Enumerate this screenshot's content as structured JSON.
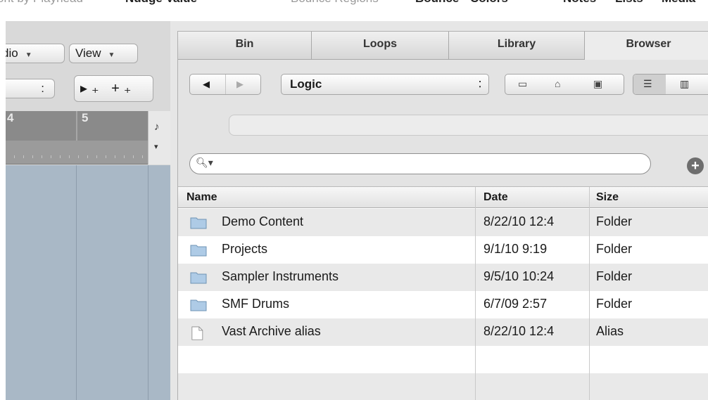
{
  "top_toolbar": {
    "cropped_left": "ont by Playhead",
    "nudge_value": "Nudge Value",
    "bounce_regions": "Bounce Regions",
    "bounce": "Bounce",
    "colors": "Colors",
    "notes": "Notes",
    "lists": "Lists",
    "media": "Media"
  },
  "arrange": {
    "audio_menu": "dio",
    "view_menu": "View",
    "stepper_value": ":",
    "tools": "▸₊ +₊",
    "ruler_bar_4": "4",
    "ruler_bar_5": "5",
    "ruler_note": "♪",
    "ruler_arrow": "▾"
  },
  "browser": {
    "tabs": [
      {
        "label": "Bin",
        "active": false
      },
      {
        "label": "Loops",
        "active": false
      },
      {
        "label": "Library",
        "active": false
      },
      {
        "label": "Browser",
        "active": true
      }
    ],
    "location": "Logic",
    "search": {
      "value": "",
      "placeholder": ""
    },
    "columns": {
      "name": "Name",
      "date": "Date",
      "size": "Size"
    },
    "rows": [
      {
        "icon": "folder-icon",
        "name": "Demo Content",
        "date": "8/22/10 12:4",
        "size": "Folder"
      },
      {
        "icon": "folder-icon",
        "name": "Projects",
        "date": "9/1/10 9:19",
        "size": "Folder"
      },
      {
        "icon": "folder-icon",
        "name": "Sampler Instruments",
        "date": "9/5/10 10:24",
        "size": "Folder"
      },
      {
        "icon": "folder-icon",
        "name": "SMF Drums",
        "date": "6/7/09 2:57",
        "size": "Folder"
      },
      {
        "icon": "alias-file-icon",
        "name": "Vast Archive alias",
        "date": "8/22/10 12:4",
        "size": "Alias"
      }
    ]
  },
  "colors": {
    "track_area": "#a9b8c6",
    "ruler": "#8a8a8a",
    "folder": "#aecbe6"
  }
}
